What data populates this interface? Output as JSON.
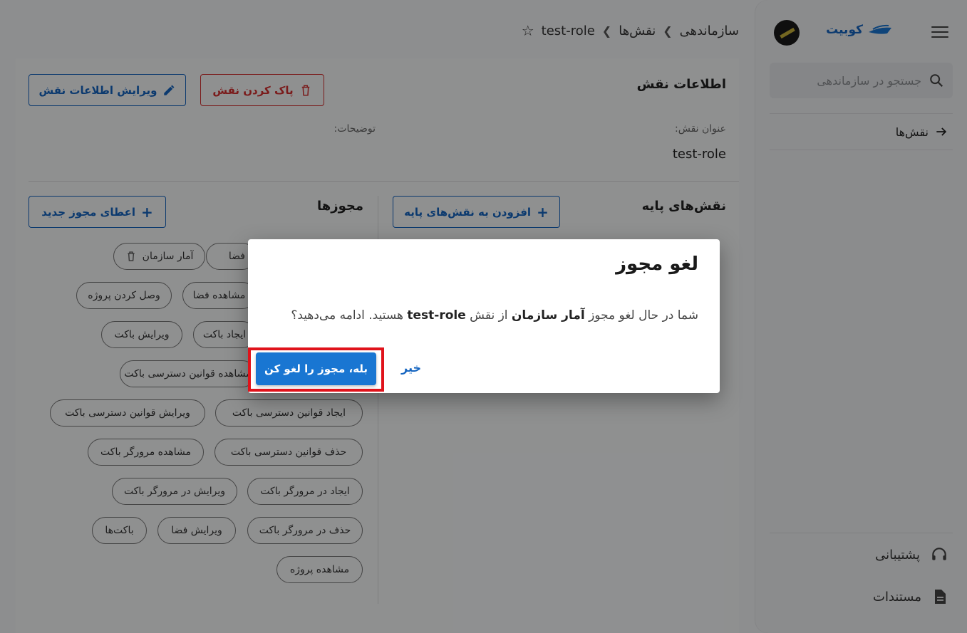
{
  "sidebar": {
    "brand": "کوبیت",
    "search_placeholder": "جستجو در سازماندهی",
    "nav_item": "نقش‌ها",
    "support": "پشتیبانی",
    "docs": "مستندات"
  },
  "breadcrumb": {
    "item1": "سازماندهی",
    "item2": "نقش‌ها",
    "item3": "test-role"
  },
  "role_info": {
    "title": "اطلاعات نقش",
    "delete_label": "پاک کردن نقش",
    "edit_label": "ویرایش اطلاعات نقش",
    "name_label": "عنوان نقش:",
    "name_value": "test-role",
    "desc_label": "توضیحات:"
  },
  "base_roles": {
    "title": "نقش‌های پایه",
    "add_label": "افزودن به نقش‌های پایه"
  },
  "permissions": {
    "title": "مجوزها",
    "grant_label": "اعطای مجوز جدید",
    "chips": [
      "فضا",
      "آمار سازمان",
      "وصل کردن پروژه",
      "مشاهده فضا",
      "ایجاد باکت",
      "ویرایش باکت",
      "مشاهده قوانین دسترسی باکت",
      "ایجاد قوانین دسترسی باکت",
      "ویرایش قوانین دسترسی باکت",
      "حذف قوانین دسترسی باکت",
      "مشاهده مرورگر باکت",
      "ایجاد در مرورگر باکت",
      "ویرایش در مرورگر باکت",
      "حذف در مرورگر باکت",
      "ویرایش فضا",
      "باکت‌ها",
      "مشاهده پروژه"
    ]
  },
  "dialog": {
    "title": "لغو مجوز",
    "msg_part1": "شما در حال لغو مجوز",
    "msg_perm": "آمار سازمان",
    "msg_part2": "از نقش",
    "msg_role": "test-role",
    "msg_part3": "هستید. ادامه می‌دهید؟",
    "confirm_label": "بله، مجوز را لغو کن",
    "cancel_label": "خیر"
  },
  "colors": {
    "primary": "#1976d2",
    "danger": "#d32f2f",
    "highlight": "#e0131b"
  }
}
